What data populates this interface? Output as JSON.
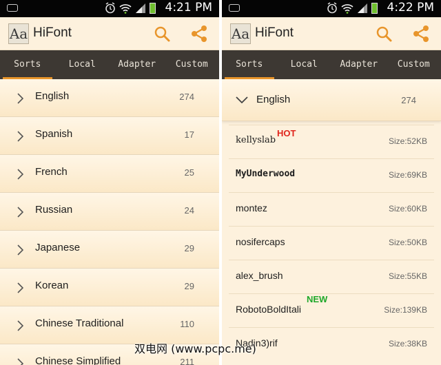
{
  "left": {
    "status": {
      "time": "4:21 PM"
    },
    "app_title": "HiFont",
    "logo_text": "Aa",
    "tabs": [
      "Sorts",
      "Local",
      "Adapter",
      "Custom"
    ],
    "active_tab": 0,
    "categories": [
      {
        "label": "English",
        "count": "274"
      },
      {
        "label": "Spanish",
        "count": "17"
      },
      {
        "label": "French",
        "count": "25"
      },
      {
        "label": "Russian",
        "count": "24"
      },
      {
        "label": "Japanese",
        "count": "29"
      },
      {
        "label": "Korean",
        "count": "29"
      },
      {
        "label": "Chinese Traditional",
        "count": "110"
      },
      {
        "label": "Chinese Simplified",
        "count": "211"
      }
    ]
  },
  "right": {
    "status": {
      "time": "4:22 PM"
    },
    "app_title": "HiFont",
    "logo_text": "Aa",
    "tabs": [
      "Sorts",
      "Local",
      "Adapter",
      "Custom"
    ],
    "active_tab": 0,
    "expanded_category": {
      "label": "English",
      "count": "274"
    },
    "fonts": [
      {
        "name": "kellyslab",
        "size": "Size:52KB",
        "badge": "HOT"
      },
      {
        "name": "MyUnderwood",
        "size": "Size:69KB",
        "badge": ""
      },
      {
        "name": "montez",
        "size": "Size:60KB",
        "badge": ""
      },
      {
        "name": "nosifercaps",
        "size": "Size:50KB",
        "badge": ""
      },
      {
        "name": "alex_brush",
        "size": "Size:55KB",
        "badge": ""
      },
      {
        "name": "RobotoBoldItali",
        "size": "Size:139KB",
        "badge": "NEW"
      },
      {
        "name": "Nadin3)rif",
        "size": "Size:38KB",
        "badge": ""
      }
    ]
  },
  "watermark": "双电网 (www.pcpc.me)",
  "colors": {
    "accent": "#e8952b",
    "tab_bg": "#3d3833",
    "panel_bg": "#fdf1dd",
    "hot": "#e0261d",
    "new": "#1fa82a"
  }
}
